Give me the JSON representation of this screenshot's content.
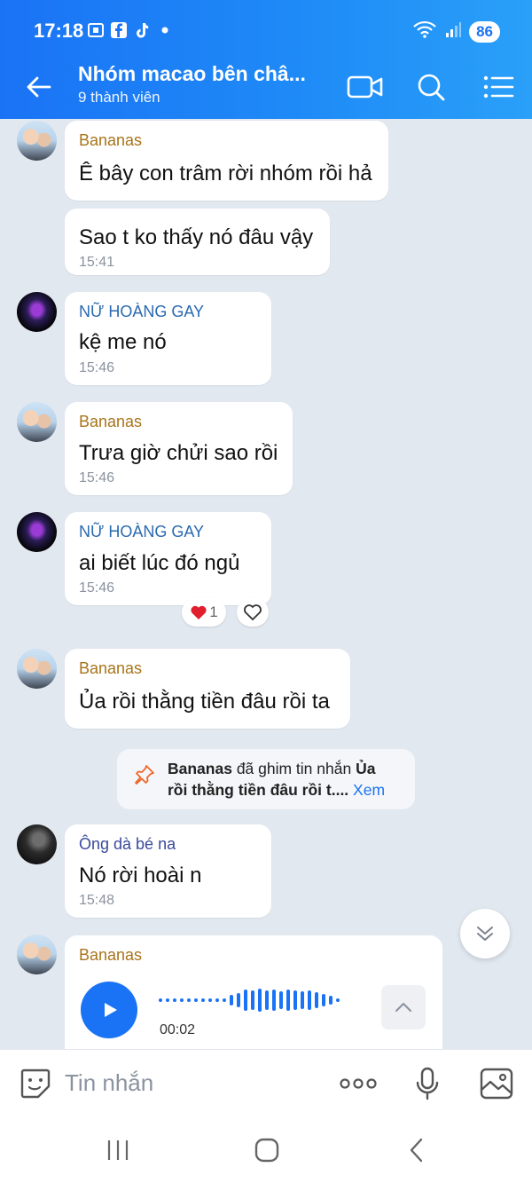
{
  "status": {
    "time": "17:18",
    "battery": "86"
  },
  "header": {
    "title": "Nhóm macao bên châ...",
    "subtitle": "9 thành viên"
  },
  "messages": [
    {
      "sender": "Bananas",
      "text": "Ê bây con trâm rời nhóm rồi hả"
    },
    {
      "text": "Sao t ko thấy nó đâu vậy",
      "time": "15:41"
    },
    {
      "sender": "NỮ HOÀNG GAY",
      "text": "kệ me nó",
      "time": "15:46"
    },
    {
      "sender": "Bananas",
      "text": "Trưa giờ chửi sao rồi",
      "time": "15:46"
    },
    {
      "sender": "NỮ HOÀNG GAY",
      "text": "ai biết lúc đó ngủ",
      "time": "15:46",
      "reaction_count": "1"
    },
    {
      "sender": "Bananas",
      "text": "Ủa rồi thằng tiền đâu rồi ta"
    },
    {
      "sender": "Ông dà bé na",
      "text": "Nó rời hoài n",
      "time": "15:48"
    },
    {
      "sender": "Bananas",
      "voice_duration": "00:02"
    }
  ],
  "pin_notice": {
    "actor": "Bananas",
    "action": " đã ghim tin nhắn ",
    "pinned_start": "Ủa",
    "pinned_rest": "rồi thằng tiền đâu rồi t....",
    "view_label": "Xem"
  },
  "composer": {
    "placeholder": "Tin nhắn",
    "more_label": "ooo"
  },
  "colors": {
    "accent": "#1a73f5",
    "sender_gold": "#a8741a",
    "sender_blue": "#2a6ab0",
    "background": "#e2e8f0"
  }
}
